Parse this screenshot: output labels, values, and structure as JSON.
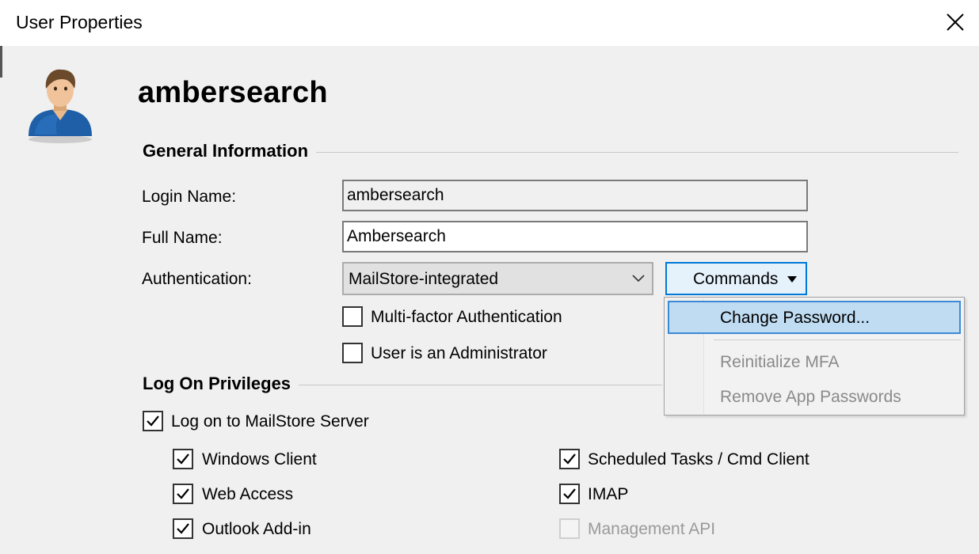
{
  "window": {
    "title": "User Properties"
  },
  "user": {
    "display_name": "ambersearch"
  },
  "general": {
    "heading": "General Information",
    "login_name_label": "Login Name:",
    "login_name_value": "ambersearch",
    "full_name_label": "Full Name:",
    "full_name_value": "Ambersearch",
    "authentication_label": "Authentication:",
    "authentication_value": "MailStore-integrated",
    "commands_label": "Commands",
    "mfa_label": "Multi-factor Authentication",
    "mfa_checked": false,
    "admin_label": "User is an Administrator",
    "admin_checked": false
  },
  "commands_menu": {
    "items": [
      {
        "label": "Change Password...",
        "enabled": true,
        "highlighted": true
      },
      {
        "label": "Reinitialize MFA",
        "enabled": false
      },
      {
        "label": "Remove App Passwords",
        "enabled": false
      }
    ]
  },
  "privileges": {
    "heading": "Log On Privileges",
    "logon_server_label": "Log on to MailStore Server",
    "logon_server_checked": true,
    "windows_client_label": "Windows Client",
    "web_access_label": "Web Access",
    "outlook_addin_label": "Outlook Add-in",
    "scheduled_tasks_label": "Scheduled Tasks / Cmd Client",
    "imap_label": "IMAP",
    "management_api_label": "Management API"
  },
  "colors": {
    "accent": "#0078d7",
    "menu_highlight": "#bfdcf2",
    "disabled_text": "#9a9a9a"
  }
}
